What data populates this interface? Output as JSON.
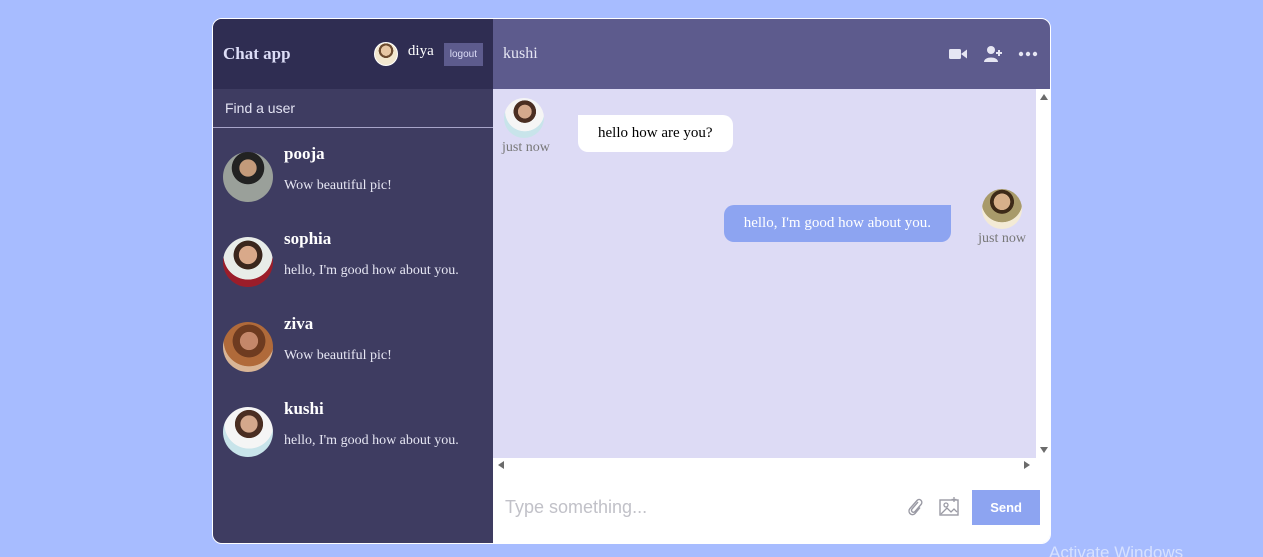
{
  "sidebar": {
    "logo": "Chat app",
    "current_user": {
      "name": "diya"
    },
    "logout_label": "logout",
    "search": {
      "placeholder": "Find a user"
    },
    "chats": [
      {
        "name": "pooja",
        "last_message": "Wow beautiful pic!"
      },
      {
        "name": "sophia",
        "last_message": "hello, I'm good how about you."
      },
      {
        "name": "ziva",
        "last_message": "Wow beautiful pic!"
      },
      {
        "name": "kushi",
        "last_message": "hello, I'm good how about you."
      }
    ]
  },
  "chat": {
    "header": {
      "title": "kushi",
      "icons": [
        "video-camera-icon",
        "add-user-icon",
        "more-options-icon"
      ]
    },
    "messages": [
      {
        "direction": "incoming",
        "text": "hello how are you?",
        "time": "just now"
      },
      {
        "direction": "outgoing",
        "text": "hello, I'm good how about you.",
        "time": "just now"
      }
    ],
    "input": {
      "placeholder": "Type something...",
      "value": "",
      "attach_icon": "paperclip-icon",
      "image_icon": "image-icon",
      "send_label": "Send"
    }
  },
  "colors": {
    "background": "#a7bcff",
    "sidebar": "#3e3c61",
    "sidebar_navbar": "#2f2d52",
    "chat_header": "#5d5b8d",
    "messages_bg": "#dddbf5",
    "outgoing_bubble": "#8da4f1",
    "send_button": "#8da4f1"
  },
  "overlay": {
    "watermark": "Activate Windows"
  }
}
